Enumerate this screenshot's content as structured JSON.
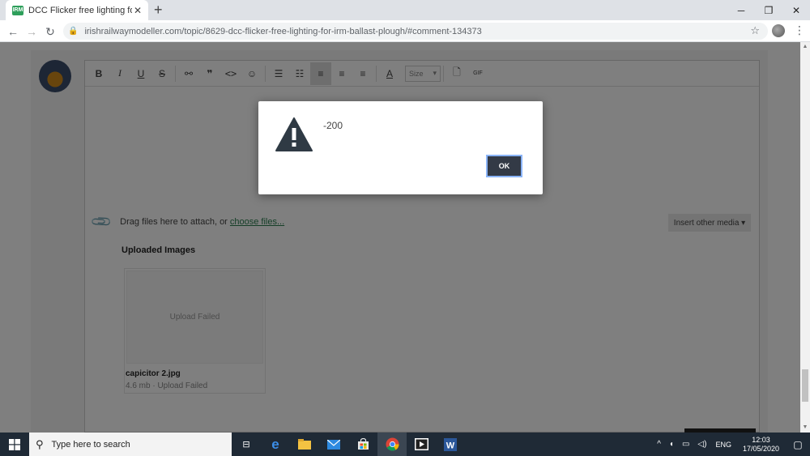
{
  "browser": {
    "tab_title": "DCC Flicker free lighting for IRM",
    "favicon_text": "IRM",
    "url": "irishrailwaymodeller.com/topic/8629-dcc-flicker-free-lighting-for-irm-ballast-plough/#comment-134373"
  },
  "editor": {
    "size_label": "Size",
    "attach_prefix": "Drag files here to attach, or ",
    "attach_link": "choose files...",
    "insert_media": "Insert other media ▾",
    "uploaded_title": "Uploaded Images",
    "upload_failed": "Upload Failed",
    "file_name": "capicitor 2.jpg",
    "file_meta": "4.6 mb · Upload Failed"
  },
  "dialog": {
    "message": "-200",
    "ok_label": "OK"
  },
  "taskbar": {
    "search_placeholder": "Type here to search",
    "language": "ENG",
    "time": "12:03",
    "date": "17/05/2020"
  },
  "colors": {
    "ok_button": "#333a46",
    "link_green": "#2a7d4f",
    "taskbar": "#1f2a36"
  }
}
